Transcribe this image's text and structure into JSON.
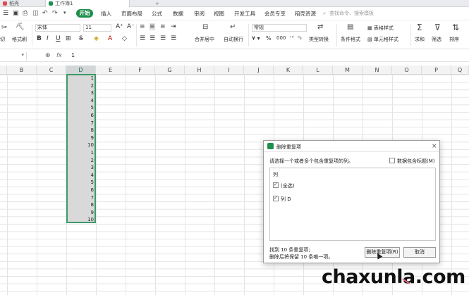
{
  "tabs": [
    {
      "label": "稻壳"
    },
    {
      "label": "工作簿1"
    }
  ],
  "menu": {
    "start": "开始",
    "items": [
      "插入",
      "页面布局",
      "公式",
      "数据",
      "审阅",
      "视图",
      "开发工具",
      "会员专享",
      "稻壳资源"
    ],
    "search": "查找命令、搜索模板"
  },
  "ribbon": {
    "cut": "切",
    "format_painter": "格式刷",
    "font": "宋体",
    "size": "11",
    "merge": "合并居中",
    "wrap": "自动换行",
    "number_format": "常规",
    "type_convert": "类型转换",
    "cond_format": "条件格式",
    "table_style": "表格样式",
    "cell_style": "单元格样式",
    "sum": "求和",
    "filter": "筛选",
    "sort": "排序"
  },
  "formula": {
    "fx": "fx",
    "value": "1"
  },
  "columns": [
    "B",
    "C",
    "D",
    "E",
    "F",
    "G",
    "H",
    "I",
    "J",
    "K",
    "L",
    "M",
    "N",
    "O",
    "P",
    "Q"
  ],
  "selected_column": "D",
  "cells": [
    "1",
    "2",
    "3",
    "4",
    "5",
    "6",
    "7",
    "8",
    "9",
    "10",
    "1",
    "2",
    "3",
    "4",
    "5",
    "6",
    "7",
    "8",
    "9",
    "10"
  ],
  "dialog": {
    "title": "删除重复项",
    "prompt": "请选择一个或者多个包含重复项的列。",
    "header_checkbox": "数据包含标题(M)",
    "list_header": "列",
    "items": [
      {
        "label": "(全选)",
        "checked": true
      },
      {
        "label": "列 D",
        "checked": true
      }
    ],
    "status_line1": "找到 10 条重复项;",
    "status_line2": "删除后将保留 10 条唯一项。",
    "delete_button": "删除重复项(R)",
    "cancel_button": "取消"
  },
  "watermark": "chaxunla.com",
  "colors": {
    "accent": "#1e8f4c",
    "selection_border": "#3c9a68"
  }
}
